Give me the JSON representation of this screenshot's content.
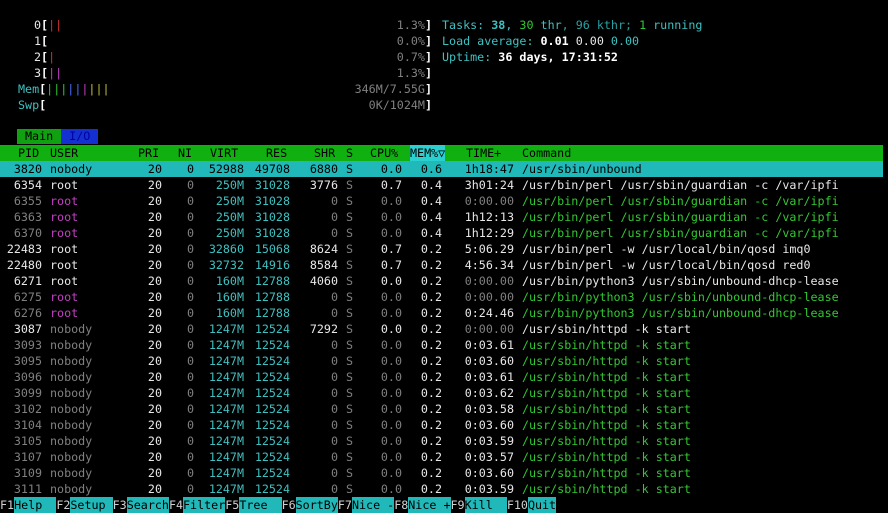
{
  "meters": {
    "cpu0": {
      "label": "0",
      "bar": "||",
      "value": "1.3%"
    },
    "cpu1": {
      "label": "1",
      "bar": "",
      "value": "0.0%"
    },
    "cpu2": {
      "label": "2",
      "bar": "|",
      "value": "0.7%"
    },
    "cpu3": {
      "label": "3",
      "bar": "||",
      "value": "1.3%"
    },
    "mem": {
      "label": "Mem",
      "bar": "|||||||||",
      "value": "346M/7.55G"
    },
    "swp": {
      "label": "Swp",
      "bar": "",
      "value": "0K/1024M"
    }
  },
  "summary": {
    "tasks_label": "Tasks: ",
    "tasks": "38",
    "tasks_sep": ", ",
    "thr": "30",
    "thr_label": " thr",
    "kthr_part": ", 96 kthr; ",
    "running": "1",
    "running_label": " running",
    "load_label": "Load average: ",
    "load1": "0.01",
    "load5": "0.00",
    "load15": "0.00",
    "uptime_label": "Uptime: ",
    "uptime": "36 days, 17:31:52"
  },
  "tabs": {
    "main": "Main",
    "io": "I/O"
  },
  "columns": {
    "pid": "PID",
    "user": "USER",
    "pri": "PRI",
    "ni": "NI",
    "virt": "VIRT",
    "res": "RES",
    "shr": "SHR",
    "s": "S",
    "cpu": "CPU%",
    "mem": "MEM%▽",
    "time": "TIME+",
    "command": "Command"
  },
  "processes": [
    {
      "pid": "3820",
      "user": "nobody",
      "pri": "20",
      "ni": "0",
      "virt": "52988",
      "res": "49708",
      "shr": "6880",
      "s": "S",
      "cpu": "0.0",
      "mem": "0.6",
      "time": "1h18:47",
      "command": "/usr/sbin/unbound"
    },
    {
      "pid": "6354",
      "user": "root",
      "pri": "20",
      "ni": "0",
      "virt": "250M",
      "res": "31028",
      "shr": "3776",
      "s": "S",
      "cpu": "0.7",
      "mem": "0.4",
      "time": "3h01:24",
      "command": "/usr/bin/perl /usr/sbin/guardian -c /var/ipfi"
    },
    {
      "pid": "6355",
      "user": "root",
      "pri": "20",
      "ni": "0",
      "virt": "250M",
      "res": "31028",
      "shr": "0",
      "s": "S",
      "cpu": "0.0",
      "mem": "0.4",
      "time": "0:00.00",
      "command": "/usr/bin/perl /usr/sbin/guardian -c /var/ipfi"
    },
    {
      "pid": "6363",
      "user": "root",
      "pri": "20",
      "ni": "0",
      "virt": "250M",
      "res": "31028",
      "shr": "0",
      "s": "S",
      "cpu": "0.0",
      "mem": "0.4",
      "time": "1h12:13",
      "command": "/usr/bin/perl /usr/sbin/guardian -c /var/ipfi"
    },
    {
      "pid": "6370",
      "user": "root",
      "pri": "20",
      "ni": "0",
      "virt": "250M",
      "res": "31028",
      "shr": "0",
      "s": "S",
      "cpu": "0.0",
      "mem": "0.4",
      "time": "1h12:29",
      "command": "/usr/bin/perl /usr/sbin/guardian -c /var/ipfi"
    },
    {
      "pid": "22483",
      "user": "root",
      "pri": "20",
      "ni": "0",
      "virt": "32860",
      "res": "15068",
      "shr": "8624",
      "s": "S",
      "cpu": "0.7",
      "mem": "0.2",
      "time": "5:06.29",
      "command": "/usr/bin/perl -w /usr/local/bin/qosd imq0"
    },
    {
      "pid": "22480",
      "user": "root",
      "pri": "20",
      "ni": "0",
      "virt": "32732",
      "res": "14916",
      "shr": "8584",
      "s": "S",
      "cpu": "0.7",
      "mem": "0.2",
      "time": "4:56.34",
      "command": "/usr/bin/perl -w /usr/local/bin/qosd red0"
    },
    {
      "pid": "6271",
      "user": "root",
      "pri": "20",
      "ni": "0",
      "virt": "160M",
      "res": "12788",
      "shr": "4060",
      "s": "S",
      "cpu": "0.0",
      "mem": "0.2",
      "time": "0:00.00",
      "command": "/usr/bin/python3 /usr/sbin/unbound-dhcp-lease"
    },
    {
      "pid": "6275",
      "user": "root",
      "pri": "20",
      "ni": "0",
      "virt": "160M",
      "res": "12788",
      "shr": "0",
      "s": "S",
      "cpu": "0.0",
      "mem": "0.2",
      "time": "0:00.00",
      "command": "/usr/bin/python3 /usr/sbin/unbound-dhcp-lease"
    },
    {
      "pid": "6276",
      "user": "root",
      "pri": "20",
      "ni": "0",
      "virt": "160M",
      "res": "12788",
      "shr": "0",
      "s": "S",
      "cpu": "0.0",
      "mem": "0.2",
      "time": "0:24.46",
      "command": "/usr/bin/python3 /usr/sbin/unbound-dhcp-lease"
    },
    {
      "pid": "3087",
      "user": "nobody",
      "pri": "20",
      "ni": "0",
      "virt": "1247M",
      "res": "12524",
      "shr": "7292",
      "s": "S",
      "cpu": "0.0",
      "mem": "0.2",
      "time": "0:00.00",
      "command": "/usr/sbin/httpd -k start"
    },
    {
      "pid": "3093",
      "user": "nobody",
      "pri": "20",
      "ni": "0",
      "virt": "1247M",
      "res": "12524",
      "shr": "0",
      "s": "S",
      "cpu": "0.0",
      "mem": "0.2",
      "time": "0:03.61",
      "command": "/usr/sbin/httpd -k start"
    },
    {
      "pid": "3095",
      "user": "nobody",
      "pri": "20",
      "ni": "0",
      "virt": "1247M",
      "res": "12524",
      "shr": "0",
      "s": "S",
      "cpu": "0.0",
      "mem": "0.2",
      "time": "0:03.60",
      "command": "/usr/sbin/httpd -k start"
    },
    {
      "pid": "3096",
      "user": "nobody",
      "pri": "20",
      "ni": "0",
      "virt": "1247M",
      "res": "12524",
      "shr": "0",
      "s": "S",
      "cpu": "0.0",
      "mem": "0.2",
      "time": "0:03.61",
      "command": "/usr/sbin/httpd -k start"
    },
    {
      "pid": "3099",
      "user": "nobody",
      "pri": "20",
      "ni": "0",
      "virt": "1247M",
      "res": "12524",
      "shr": "0",
      "s": "S",
      "cpu": "0.0",
      "mem": "0.2",
      "time": "0:03.62",
      "command": "/usr/sbin/httpd -k start"
    },
    {
      "pid": "3102",
      "user": "nobody",
      "pri": "20",
      "ni": "0",
      "virt": "1247M",
      "res": "12524",
      "shr": "0",
      "s": "S",
      "cpu": "0.0",
      "mem": "0.2",
      "time": "0:03.58",
      "command": "/usr/sbin/httpd -k start"
    },
    {
      "pid": "3104",
      "user": "nobody",
      "pri": "20",
      "ni": "0",
      "virt": "1247M",
      "res": "12524",
      "shr": "0",
      "s": "S",
      "cpu": "0.0",
      "mem": "0.2",
      "time": "0:03.60",
      "command": "/usr/sbin/httpd -k start"
    },
    {
      "pid": "3105",
      "user": "nobody",
      "pri": "20",
      "ni": "0",
      "virt": "1247M",
      "res": "12524",
      "shr": "0",
      "s": "S",
      "cpu": "0.0",
      "mem": "0.2",
      "time": "0:03.59",
      "command": "/usr/sbin/httpd -k start"
    },
    {
      "pid": "3107",
      "user": "nobody",
      "pri": "20",
      "ni": "0",
      "virt": "1247M",
      "res": "12524",
      "shr": "0",
      "s": "S",
      "cpu": "0.0",
      "mem": "0.2",
      "time": "0:03.57",
      "command": "/usr/sbin/httpd -k start"
    },
    {
      "pid": "3109",
      "user": "nobody",
      "pri": "20",
      "ni": "0",
      "virt": "1247M",
      "res": "12524",
      "shr": "0",
      "s": "S",
      "cpu": "0.0",
      "mem": "0.2",
      "time": "0:03.60",
      "command": "/usr/sbin/httpd -k start"
    },
    {
      "pid": "3111",
      "user": "nobody",
      "pri": "20",
      "ni": "0",
      "virt": "1247M",
      "res": "12524",
      "shr": "0",
      "s": "S",
      "cpu": "0.0",
      "mem": "0.2",
      "time": "0:03.59",
      "command": "/usr/sbin/httpd -k start"
    }
  ],
  "function_keys": [
    {
      "key": "F1",
      "label": "Help  "
    },
    {
      "key": "F2",
      "label": "Setup "
    },
    {
      "key": "F3",
      "label": "Search"
    },
    {
      "key": "F4",
      "label": "Filter"
    },
    {
      "key": "F5",
      "label": "Tree  "
    },
    {
      "key": "F6",
      "label": "SortBy"
    },
    {
      "key": "F7",
      "label": "Nice -"
    },
    {
      "key": "F8",
      "label": "Nice +"
    },
    {
      "key": "F9",
      "label": "Kill  "
    },
    {
      "key": "F10",
      "label": "Quit"
    }
  ]
}
